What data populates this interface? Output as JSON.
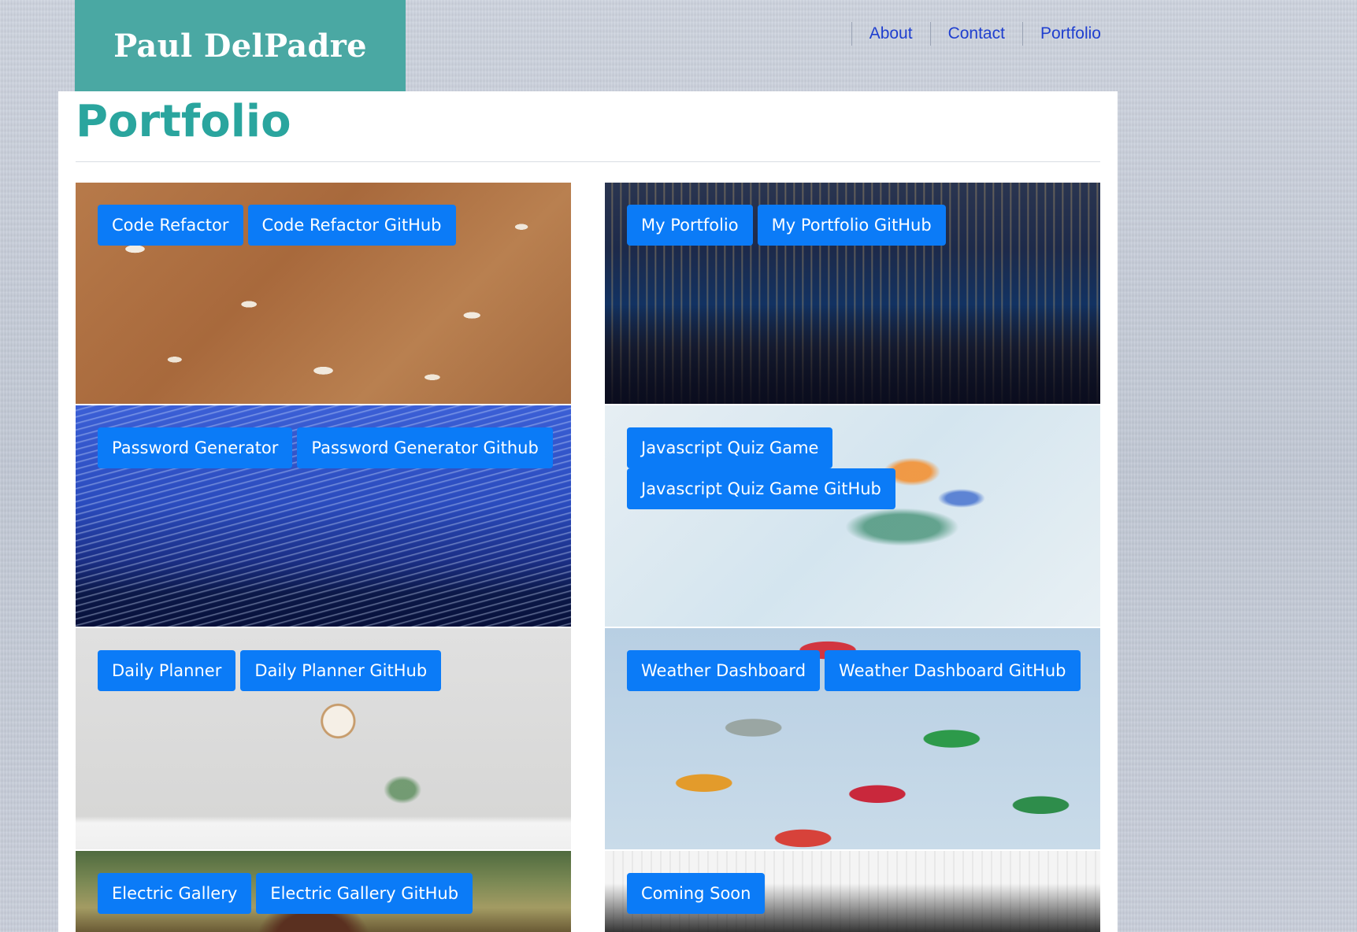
{
  "header": {
    "brand": "Paul DelPadre",
    "brand_color": "#4aa8a3",
    "nav": [
      {
        "label": "About"
      },
      {
        "label": "Contact"
      },
      {
        "label": "Portfolio"
      }
    ],
    "nav_color": "#1f3fcf"
  },
  "main": {
    "title": "Portfolio",
    "title_color": "#2aa59e",
    "button_color": "#0b7bf7",
    "tiles": [
      {
        "image": "cracked-sand-photo",
        "buttons": [
          {
            "label": "Code Refactor"
          },
          {
            "label": "Code Refactor GitHub"
          }
        ]
      },
      {
        "image": "city-skyline-photo",
        "buttons": [
          {
            "label": "My Portfolio"
          },
          {
            "label": "My Portfolio GitHub"
          }
        ]
      },
      {
        "image": "star-trails-photo",
        "buttons": [
          {
            "label": "Password Generator"
          },
          {
            "label": "Password Generator Github"
          }
        ]
      },
      {
        "image": "bird-of-paradise-photo",
        "buttons": [
          {
            "label": "Javascript Quiz Game"
          },
          {
            "label": "Javascript Quiz Game GitHub"
          }
        ]
      },
      {
        "image": "wall-clock-desk-photo",
        "buttons": [
          {
            "label": "Daily Planner"
          },
          {
            "label": "Daily Planner GitHub"
          }
        ]
      },
      {
        "image": "umbrellas-photo",
        "buttons": [
          {
            "label": "Weather Dashboard"
          },
          {
            "label": "Weather Dashboard GitHub"
          }
        ]
      },
      {
        "image": "painting-photo",
        "buttons": [
          {
            "label": "Electric Gallery"
          },
          {
            "label": "Electric Gallery GitHub"
          }
        ]
      },
      {
        "image": "escalator-photo",
        "buttons": [
          {
            "label": "Coming Soon"
          }
        ]
      }
    ]
  }
}
